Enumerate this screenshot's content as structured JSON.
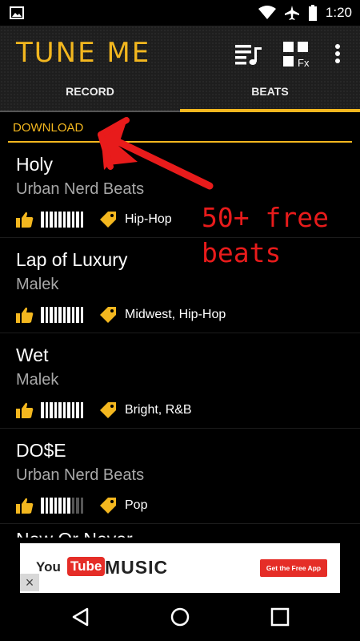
{
  "status_bar": {
    "time": "1:20"
  },
  "app": {
    "title": "TUNE ME"
  },
  "tabs": [
    {
      "label": "RECORD",
      "selected": false
    },
    {
      "label": "BEATS",
      "selected": true
    }
  ],
  "section": {
    "label": "DOWNLOAD"
  },
  "beats": [
    {
      "title": "Holy",
      "artist": "Urban Nerd Beats",
      "rating": 1.0,
      "genre": "Hip-Hop"
    },
    {
      "title": "Lap of Luxury",
      "artist": "Malek",
      "rating": 1.0,
      "genre": "Midwest, Hip-Hop"
    },
    {
      "title": "Wet",
      "artist": "Malek",
      "rating": 1.0,
      "genre": "Bright, R&B"
    },
    {
      "title": "DO$E",
      "artist": "Urban Nerd Beats",
      "rating": 0.7,
      "genre": "Pop"
    }
  ],
  "partial_item": {
    "title": "Now Or Never"
  },
  "ad": {
    "brand_you": "You",
    "brand_tube": "Tube",
    "brand_music": "MUSIC",
    "cta": "Get the Free App",
    "close": "×"
  },
  "annotation": {
    "line1": "50+ free",
    "line2": "beats"
  },
  "colors": {
    "accent": "#f3b71f",
    "annotation": "#e81b1b",
    "background": "#000000"
  },
  "icons": {
    "status": [
      "image-icon",
      "wifi-icon",
      "airplane-icon",
      "battery-icon"
    ],
    "actions": [
      "playlist-icon",
      "fx-grid-icon",
      "more-vert-icon"
    ],
    "row": [
      "thumbs-up-icon",
      "tag-icon"
    ],
    "nav": [
      "back-icon",
      "home-icon",
      "recents-icon"
    ]
  }
}
